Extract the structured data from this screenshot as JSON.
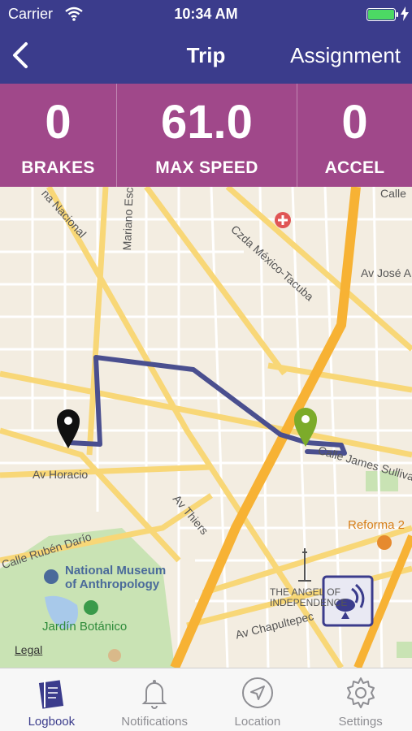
{
  "status_bar": {
    "carrier": "Carrier",
    "time": "10:34 AM",
    "battery_color": "#4cd964"
  },
  "nav": {
    "title": "Trip",
    "right_action": "Assignment"
  },
  "stats": [
    {
      "value": "0",
      "label": "BRAKES"
    },
    {
      "value": "61.0",
      "label": "MAX SPEED"
    },
    {
      "value": "0",
      "label": "ACCEL"
    }
  ],
  "map": {
    "labels": {
      "calle_top": "Calle",
      "av_jose": "Av José A",
      "nacional": "na Nacional",
      "czda": "Czda México-Tacuba",
      "mariano": "Mariano Escobedo",
      "av_horacio": "Av Horacio",
      "av_thiers": "Av Thiers",
      "james": "Calle James Sulliva",
      "reforma": "Reforma 2",
      "ruben": "Calle Rubén Darío",
      "museum": "National Museum of Anthropology",
      "angel": "THE ANGEL OF INDEPENDENCE",
      "jardin": "Jardín Botánico",
      "chapultepec": "Av Chapultepec"
    },
    "legal": "Legal",
    "route_color": "#4a4f8f",
    "start_pin_color": "#111111",
    "end_pin_color": "#7cab2a"
  },
  "tabs": [
    {
      "label": "Logbook",
      "icon": "logbook-icon",
      "active": true
    },
    {
      "label": "Notifications",
      "icon": "bell-icon",
      "active": false
    },
    {
      "label": "Location",
      "icon": "location-arrow-icon",
      "active": false
    },
    {
      "label": "Settings",
      "icon": "gear-icon",
      "active": false
    }
  ],
  "colors": {
    "header": "#3b3c8c",
    "stats_bg": "#a0488a",
    "tab_active": "#3b3c8c"
  }
}
